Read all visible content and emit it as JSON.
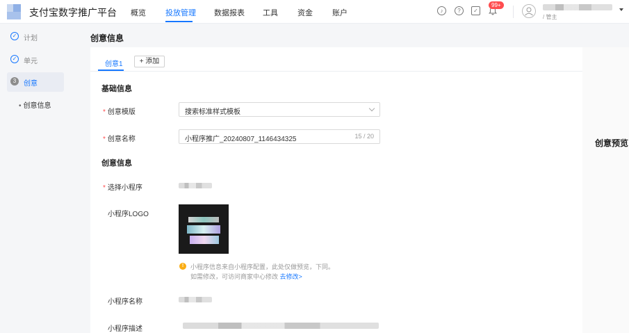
{
  "header": {
    "app_title": "支付宝数字推广平台",
    "nav": [
      "概览",
      "投放管理",
      "数据报表",
      "工具",
      "资金",
      "账户"
    ],
    "active_nav": "投放管理",
    "notification_badge": "99+",
    "account_role": "/ 管主"
  },
  "sidebar": {
    "steps": [
      {
        "label": "计划",
        "status": "done"
      },
      {
        "label": "单元",
        "status": "done"
      },
      {
        "label": "创意",
        "status": "active",
        "number": "3"
      }
    ],
    "sub_step": "创意信息"
  },
  "main": {
    "page_title": "创意信息",
    "tabs": [
      {
        "label": "创意1"
      }
    ],
    "add_button": "+ 添加",
    "basic_section": "基础信息",
    "template_label": "创意模版",
    "template_value": "搜索标准样式模板",
    "name_label": "创意名称",
    "name_value": "小程序推广_20240807_1146434325",
    "name_counter": "15 / 20",
    "creative_section": "创意信息",
    "miniapp_label": "选择小程序",
    "logo_label": "小程序LOGO",
    "hint_line1": "小程序信息来自小程序配置，此处仅做预览，下同。",
    "hint_line2": "如需修改，可访问商家中心修改",
    "hint_link": "去修改>",
    "miniapp_name_label": "小程序名称",
    "miniapp_desc_label": "小程序描述"
  },
  "preview": {
    "title": "创意预览"
  },
  "colors": {
    "accent": "#1677ff",
    "required": "#ff4d4f",
    "warning": "#faad14",
    "badge": "#ff4d4f"
  }
}
